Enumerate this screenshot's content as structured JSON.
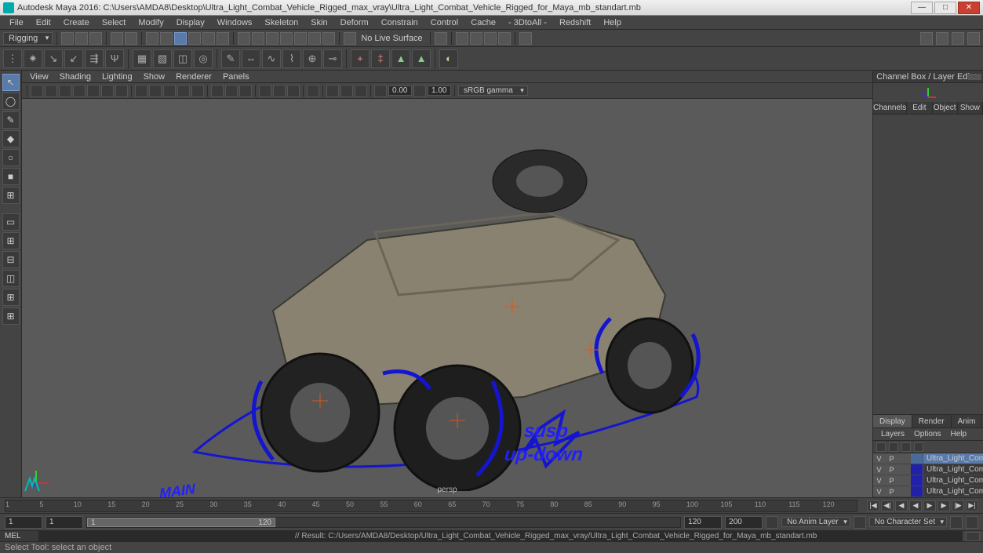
{
  "app": {
    "name": "Autodesk Maya 2016",
    "title": "Autodesk Maya 2016: C:\\Users\\AMDA8\\Desktop\\Ultra_Light_Combat_Vehicle_Rigged_max_vray\\Ultra_Light_Combat_Vehicle_Rigged_for_Maya_mb_standart.mb"
  },
  "menubar": [
    "File",
    "Edit",
    "Create",
    "Select",
    "Modify",
    "Display",
    "Windows",
    "Skeleton",
    "Skin",
    "Deform",
    "Constrain",
    "Control",
    "Cache",
    "- 3DtoAll -",
    "Redshift",
    "Help"
  ],
  "workspace": {
    "dropdown": "Rigging",
    "surface_label": "No Live Surface"
  },
  "panel_menu": [
    "View",
    "Shading",
    "Lighting",
    "Show",
    "Renderer",
    "Panels"
  ],
  "panel_toolbar": {
    "val1": "0.00",
    "val2": "1.00",
    "colorspace": "sRGB gamma"
  },
  "viewport": {
    "camera": "persp",
    "susp1": "susp",
    "susp2": "up-down",
    "main_label": "MAIN"
  },
  "channel_box": {
    "title": "Channel Box / Layer Editor",
    "tabs": [
      "Channels",
      "Edit",
      "Object",
      "Show"
    ],
    "layer_tabs": [
      "Display",
      "Render",
      "Anim"
    ],
    "layer_menu": [
      "Layers",
      "Options",
      "Help"
    ],
    "layers": [
      {
        "v": "V",
        "p": "P",
        "name": "Ultra_Light_Combat_V",
        "sel": true
      },
      {
        "v": "V",
        "p": "P",
        "name": "Ultra_Light_Combat_V",
        "sel": false
      },
      {
        "v": "V",
        "p": "P",
        "name": "Ultra_Light_Combat_V",
        "sel": false
      },
      {
        "v": "V",
        "p": "P",
        "name": "Ultra_Light_Combat_V",
        "sel": false
      }
    ]
  },
  "timeline": {
    "ticks": [
      "1",
      "5",
      "10",
      "15",
      "20",
      "25",
      "30",
      "35",
      "40",
      "45",
      "50",
      "55",
      "60",
      "65",
      "70",
      "75",
      "80",
      "85",
      "90",
      "95",
      "100",
      "105",
      "110",
      "115",
      "120"
    ],
    "range_start": "1",
    "range_inner_start": "1",
    "range_inner_end": "120",
    "range_end": "200",
    "cur": "1",
    "slider_label_left": "1",
    "slider_label_right": "120",
    "anim_layer": "No Anim Layer",
    "char_set": "No Character Set"
  },
  "command": {
    "lang": "MEL",
    "result": "// Result: C:/Users/AMDA8/Desktop/Ultra_Light_Combat_Vehicle_Rigged_max_vray/Ultra_Light_Combat_Vehicle_Rigged_for_Maya_mb_standart.mb"
  },
  "status": "Select Tool: select an object"
}
